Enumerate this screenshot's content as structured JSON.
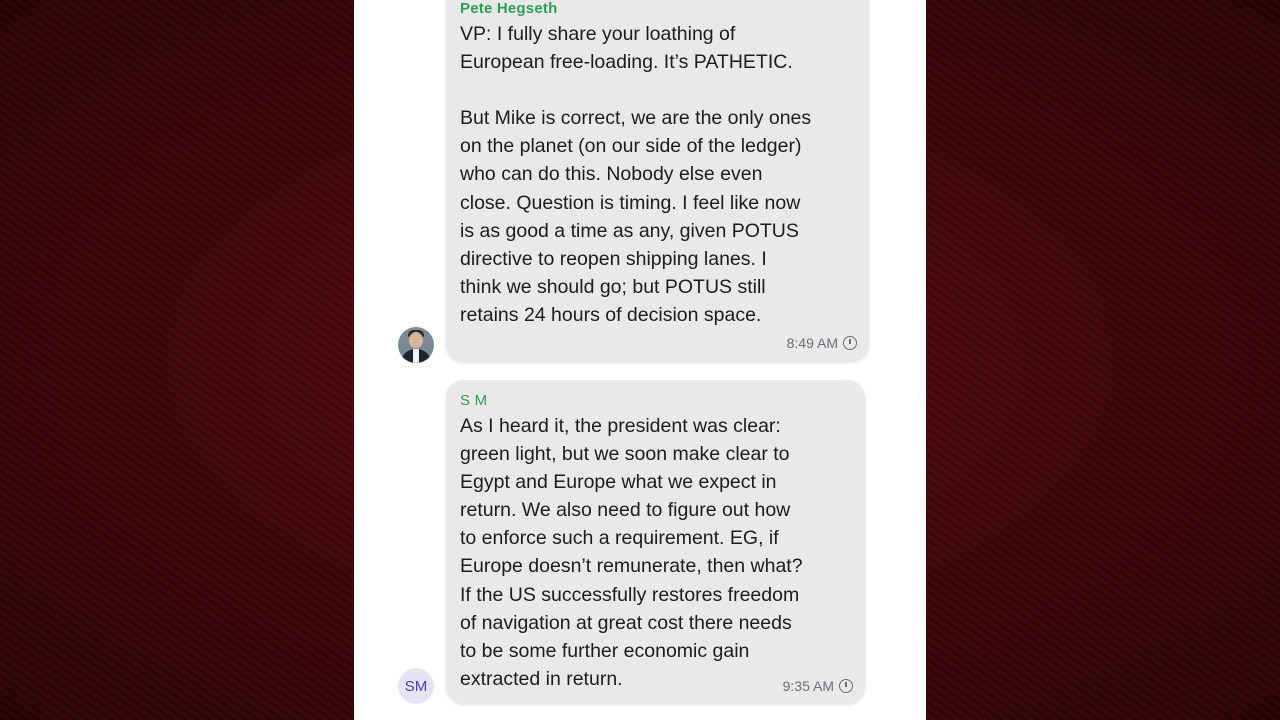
{
  "conversation": {
    "messages": [
      {
        "sender": "Pete Hegseth",
        "text": "VP: I fully share your loathing of\nEuropean free-loading. It’s PATHETIC.\n\nBut Mike is correct, we are the only ones\non the planet (on our side of the ledger)\nwho can do this. Nobody else even\nclose. Question is timing. I feel like now\nis as good a time as any, given POTUS\ndirective to reopen shipping lanes. I\nthink we should go; but POTUS still\nretains 24 hours of decision space.",
        "time": "8:49 AM",
        "avatar": "photo"
      },
      {
        "sender": "S M",
        "text": "As I heard it, the president was clear:\ngreen light, but we soon make clear to\nEgypt and Europe what we expect in\nreturn. We also need to figure out how\nto enforce such a requirement. EG, if\nEurope doesn’t remunerate, then what?\nIf the US successfully restores freedom\nof navigation at great cost there needs\nto be some further economic gain\nextracted in return.",
        "time": "9:35 AM",
        "avatar_initials": "SM"
      }
    ]
  },
  "colors": {
    "sender_name": "#2e9e55",
    "bubble": "#e9e9eb",
    "background": "#4a0a10"
  },
  "icons": {
    "timestamp": "clock-icon"
  }
}
